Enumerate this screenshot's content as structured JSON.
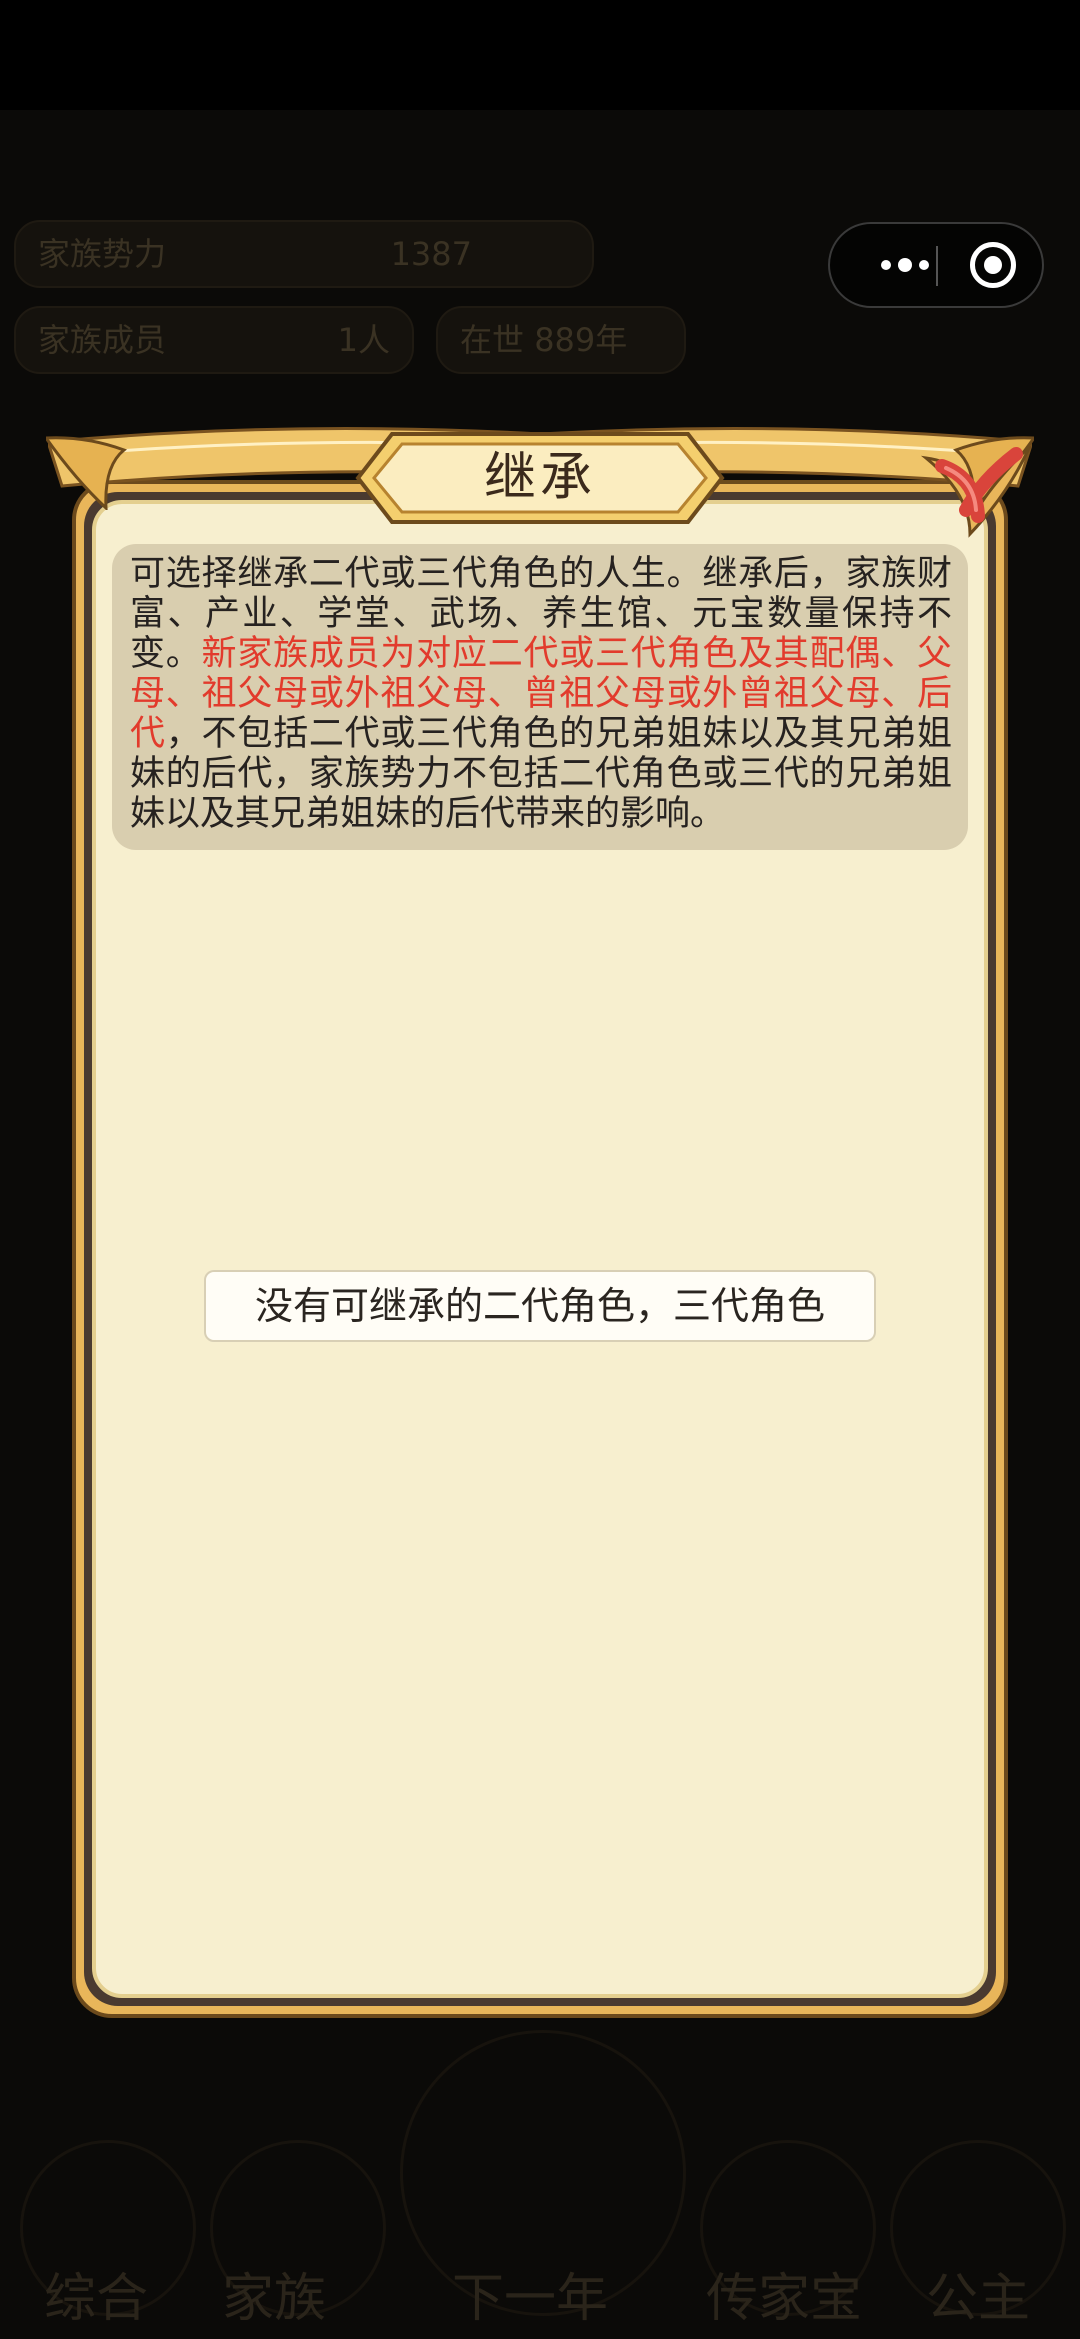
{
  "background": {
    "stat_pills": [
      {
        "label": "家族势力",
        "value": "1387"
      },
      {
        "label": "家族成员",
        "value": "1人"
      },
      {
        "label": "在世",
        "value": "889年"
      }
    ],
    "bottom_nav": [
      "综合",
      "家族",
      "下一年",
      "传家宝",
      "公主"
    ]
  },
  "dialog": {
    "title": "继承",
    "info_intro": "可选择继承二代或三代角色的人生。继承后，家族财富、产业、学堂、武场、养生馆、元宝数量保持不变。",
    "info_highlight": "新家族成员为对应二代或三代角色及其配偶、父母、祖父母或外祖父母、曾祖父母或外曾祖父母、后代",
    "info_outro": "，不包括二代或三代角色的兄弟姐妹以及其兄弟姐妹的后代，家族势力不包括二代角色或三代的兄弟姐妹以及其兄弟姐妹的后代带来的影响。",
    "empty_message": "没有可继承的二代角色，三代角色"
  },
  "icons": {
    "close": "close-icon",
    "more": "more-dots-icon",
    "miniapp_close": "target-circle-icon"
  },
  "colors": {
    "highlight": "#e23b2c",
    "panel": "#f7efcf",
    "frame": "#e9b65a",
    "close_accent": "#d9443b"
  }
}
